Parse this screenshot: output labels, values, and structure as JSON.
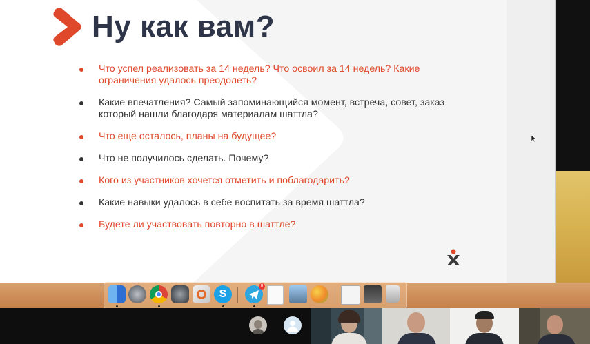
{
  "slide": {
    "title": "Ну как вам?",
    "bullets": [
      {
        "text": "Что успел реализовать за 14 недель? Что освоил за 14 недель? Какие ограничения удалось преодолеть?",
        "color": "red"
      },
      {
        "text": "Какие впечатления? Самый запоминающийся момент, встреча, совет, заказ который нашли благодаря материалам шаттла?",
        "color": "dark"
      },
      {
        "text": "Что еще осталось, планы на будущее?",
        "color": "red"
      },
      {
        "text": "Что не получилось сделать. Почему?",
        "color": "dark"
      },
      {
        "text": "Кого из участников хочется отметить и поблагодарить?",
        "color": "red"
      },
      {
        "text": "Какие навыки удалось в себе воспитать за время шаттла?",
        "color": "dark"
      },
      {
        "text": "Будете ли участвовать повторно в шаттле?",
        "color": "red"
      }
    ]
  },
  "colors": {
    "accent_red": "#e0482c",
    "text_dark": "#2e3548"
  },
  "dock": {
    "apps": [
      {
        "name": "finder-icon"
      },
      {
        "name": "launchpad-icon"
      },
      {
        "name": "chrome-icon"
      },
      {
        "name": "system-preferences-icon"
      },
      {
        "name": "utility-app-icon"
      },
      {
        "name": "skype-icon"
      },
      {
        "name": "telegram-icon",
        "badge": "8"
      },
      {
        "name": "document-icon"
      },
      {
        "name": "preview-icon"
      },
      {
        "name": "color-app-icon"
      },
      {
        "name": "recent-document-icon"
      },
      {
        "name": "minimized-window-icon"
      },
      {
        "name": "trash-icon"
      }
    ]
  },
  "video_call": {
    "participants": [
      {
        "name": "participant-avatar-photo"
      },
      {
        "name": "participant-avatar-placeholder"
      },
      {
        "name": "participant-video-1"
      },
      {
        "name": "participant-video-2"
      },
      {
        "name": "participant-video-3"
      },
      {
        "name": "participant-video-4"
      }
    ]
  }
}
